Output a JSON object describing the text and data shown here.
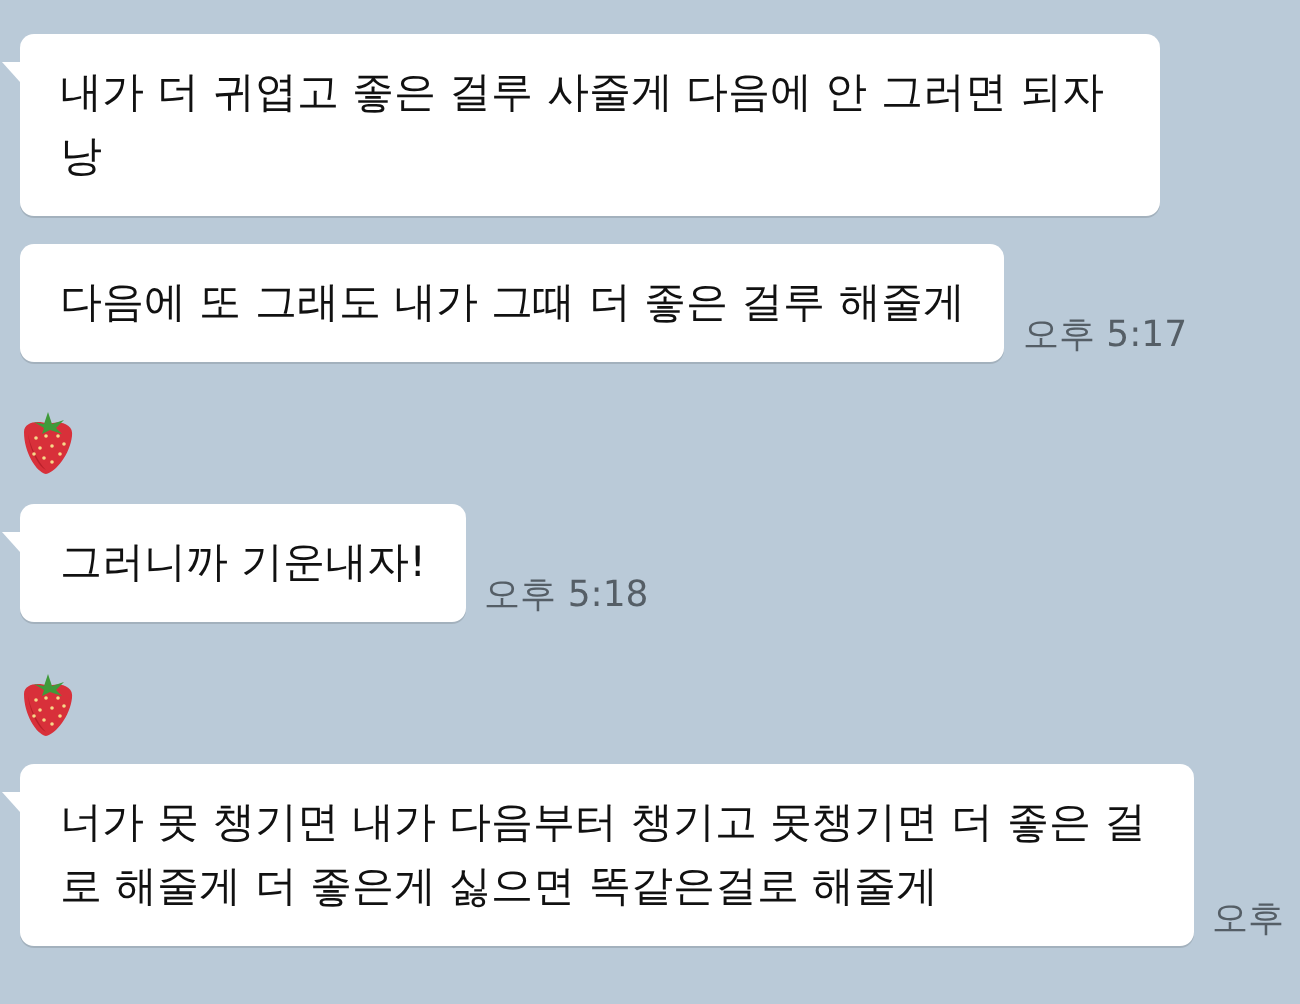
{
  "messages": [
    {
      "kind": "bubble",
      "text": "내가 더 귀엽고 좋은 걸루 사줄게 다음에 안 그러면 되자낭",
      "tail": true
    },
    {
      "kind": "bubble",
      "text": "다음에 또 그래도 내가 그때 더 좋은 걸루 해줄게",
      "tail": false,
      "time": "오후 5:17"
    },
    {
      "kind": "sticker"
    },
    {
      "kind": "bubble",
      "text": "그러니까 기운내자!",
      "tail": true,
      "time": "오후 5:18"
    },
    {
      "kind": "sticker"
    },
    {
      "kind": "bubble",
      "text": "너가 못 챙기면 내가 다음부터 챙기고 못챙기면 더 좋은 걸로 해줄게 더 좋은게 싫으면 똑같은걸로 해줄게",
      "tail": true,
      "time": "오후"
    }
  ]
}
